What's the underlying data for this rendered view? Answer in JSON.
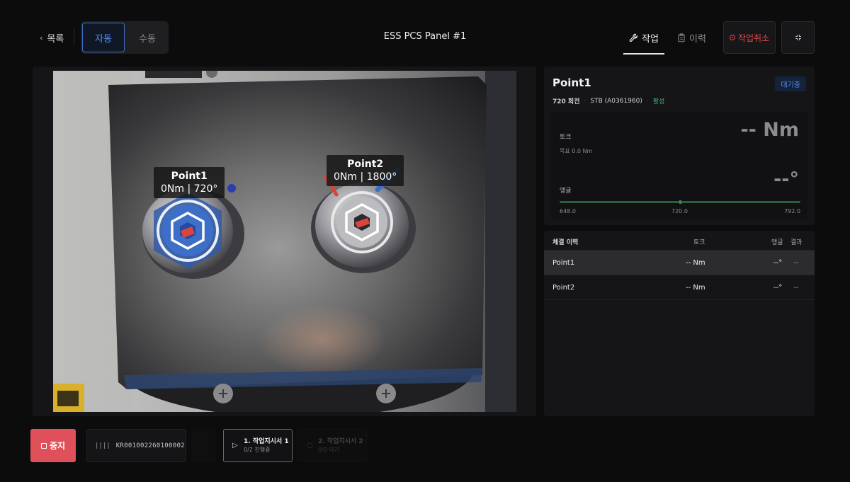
{
  "header": {
    "back_label": "목록",
    "modes": [
      {
        "label": "자동",
        "active": true
      },
      {
        "label": "수동",
        "active": false
      }
    ],
    "title": "ESS PCS Panel #1",
    "tabs": [
      {
        "label": "작업",
        "icon": "wrench-icon",
        "active": true
      },
      {
        "label": "이력",
        "icon": "clipboard-icon",
        "active": false
      }
    ],
    "cancel_label": "작업취소",
    "expand_icon": "collapse-icon"
  },
  "camera": {
    "points": [
      {
        "name": "Point1",
        "reading": "0Nm | 720°"
      },
      {
        "name": "Point2",
        "reading": "0Nm | 1800°"
      }
    ]
  },
  "detail": {
    "name": "Point1",
    "status_badge": "대기중",
    "rotation": "720 회전",
    "tool": "STB (A0361960)",
    "state": "활성",
    "torque_label": "토크",
    "torque_value": "-- Nm",
    "target_label": "목표 0.0 Nm",
    "angle_label": "앵글",
    "angle_value": "--°",
    "range": {
      "min": "648.0",
      "mid": "720.0",
      "max": "792.0"
    },
    "range_fraction": 0.5
  },
  "history": {
    "headers": {
      "name": "체결 이력",
      "torque": "토크",
      "angle": "앵글",
      "result": "결과"
    },
    "rows": [
      {
        "name": "Point1",
        "torque": "-- Nm",
        "angle": "--°",
        "result": "--",
        "selected": true
      },
      {
        "name": "Point2",
        "torque": "-- Nm",
        "angle": "--°",
        "result": "--",
        "selected": false
      }
    ]
  },
  "footer": {
    "stop_label": "중지",
    "barcode": "KR001002260100002",
    "jobs": [
      {
        "title": "1. 작업지시서 1",
        "sub": "0/2 진행중",
        "active": true
      },
      {
        "title": "2. 작업지시서 2",
        "sub": "0/0 대기",
        "active": false
      }
    ]
  },
  "colors": {
    "accent_blue": "#3e6fc8",
    "danger_red": "#e24a4a",
    "stop_red": "#e0505a",
    "active_green": "#2fb86b"
  }
}
